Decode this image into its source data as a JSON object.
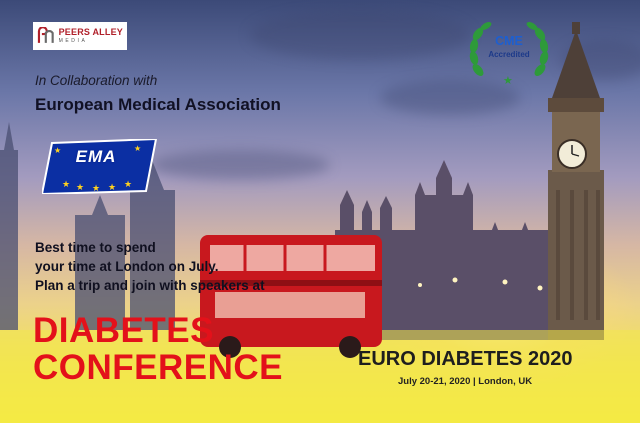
{
  "brand": {
    "logo_name": "PEERS ALLEY",
    "logo_sub": "MEDIA",
    "logo_icon": "peers-alley-logo-icon"
  },
  "collaboration": {
    "intro": "In Collaboration with",
    "organization": "European Medical Association",
    "badge_text": "EMA"
  },
  "accreditation": {
    "title": "CME",
    "subtitle": "Accredited"
  },
  "tagline": [
    "Best time to spend",
    "your time at London on July.",
    "Plan a trip and join with speakers at"
  ],
  "conference": {
    "line1": "DIABETES",
    "line2": "CONFERENCE"
  },
  "event": {
    "name": "EURO DIABETES 2020",
    "details": "July 20-21, 2020 | London, UK"
  },
  "colors": {
    "accent_red": "#e3111a",
    "ema_blue": "#0b2fa3",
    "cme_green": "#2e9a3a",
    "sky_bottom": "#f6ee3a"
  }
}
